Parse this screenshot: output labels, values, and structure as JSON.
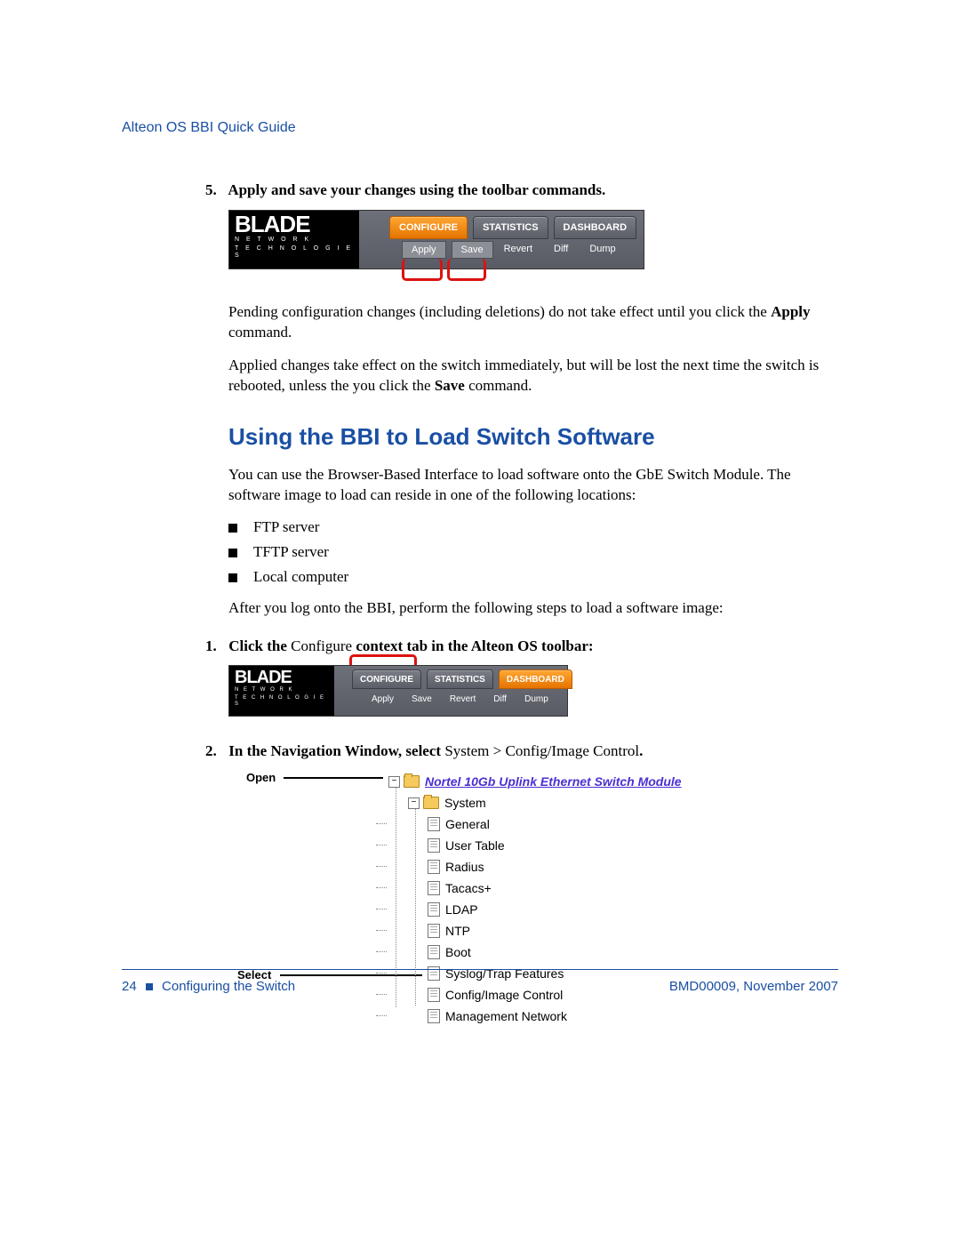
{
  "runningHead": "Alteon OS  BBI Quick Guide",
  "step5": {
    "num": "5.",
    "text": "Apply and save your changes using the toolbar commands."
  },
  "toolbar1": {
    "logo": {
      "line1": "BLADE",
      "line2": "N E T W O R K",
      "line3": "T E C H N O L O G I E S"
    },
    "tabs": {
      "configure": "CONFIGURE",
      "statistics": "STATISTICS",
      "dashboard": "DASHBOARD"
    },
    "cmds": {
      "apply": "Apply",
      "save": "Save",
      "revert": "Revert",
      "diff": "Diff",
      "dump": "Dump"
    }
  },
  "para1a": "Pending configuration changes (including deletions) do not take effect until you click the ",
  "para1b": "Apply",
  "para1c": " command.",
  "para2a": "Applied changes take effect on the switch immediately, but will be lost the next time the switch is rebooted, unless the you click the ",
  "para2b": "Save",
  "para2c": " command.",
  "h2": "Using the BBI to Load Switch Software",
  "para3": "You can use the Browser-Based Interface to load software onto the GbE Switch Module. The software image to load can reside in one of the following locations:",
  "bullets": [
    "FTP server",
    "TFTP server",
    "Local computer"
  ],
  "para4": "After you log onto the BBI, perform the following steps to load a software image:",
  "step1": {
    "num": "1.",
    "a": "Click the ",
    "b": "Configure",
    "c": " context tab in the Alteon OS toolbar:"
  },
  "toolbar2": {
    "tabs": {
      "configure": "CONFIGURE",
      "statistics": "STATISTICS",
      "dashboard": "DASHBOARD"
    },
    "cmds": {
      "apply": "Apply",
      "save": "Save",
      "revert": "Revert",
      "diff": "Diff",
      "dump": "Dump"
    }
  },
  "step2": {
    "num": "2.",
    "a": "In the Navigation Window, select ",
    "b": "System > Config/Image Control",
    "c": "."
  },
  "tree": {
    "calloutOpen": "Open",
    "calloutSelect": "Select",
    "root": "Nortel 10Gb Uplink Ethernet Switch Module",
    "system": "System",
    "items": [
      "General",
      "User Table",
      "Radius",
      "Tacacs+",
      "LDAP",
      "NTP",
      "Boot",
      "Syslog/Trap Features",
      "Config/Image Control",
      "Management Network"
    ]
  },
  "footer": {
    "pageNum": "24",
    "chapter": "Configuring the Switch",
    "docRef": "BMD00009, November 2007"
  }
}
